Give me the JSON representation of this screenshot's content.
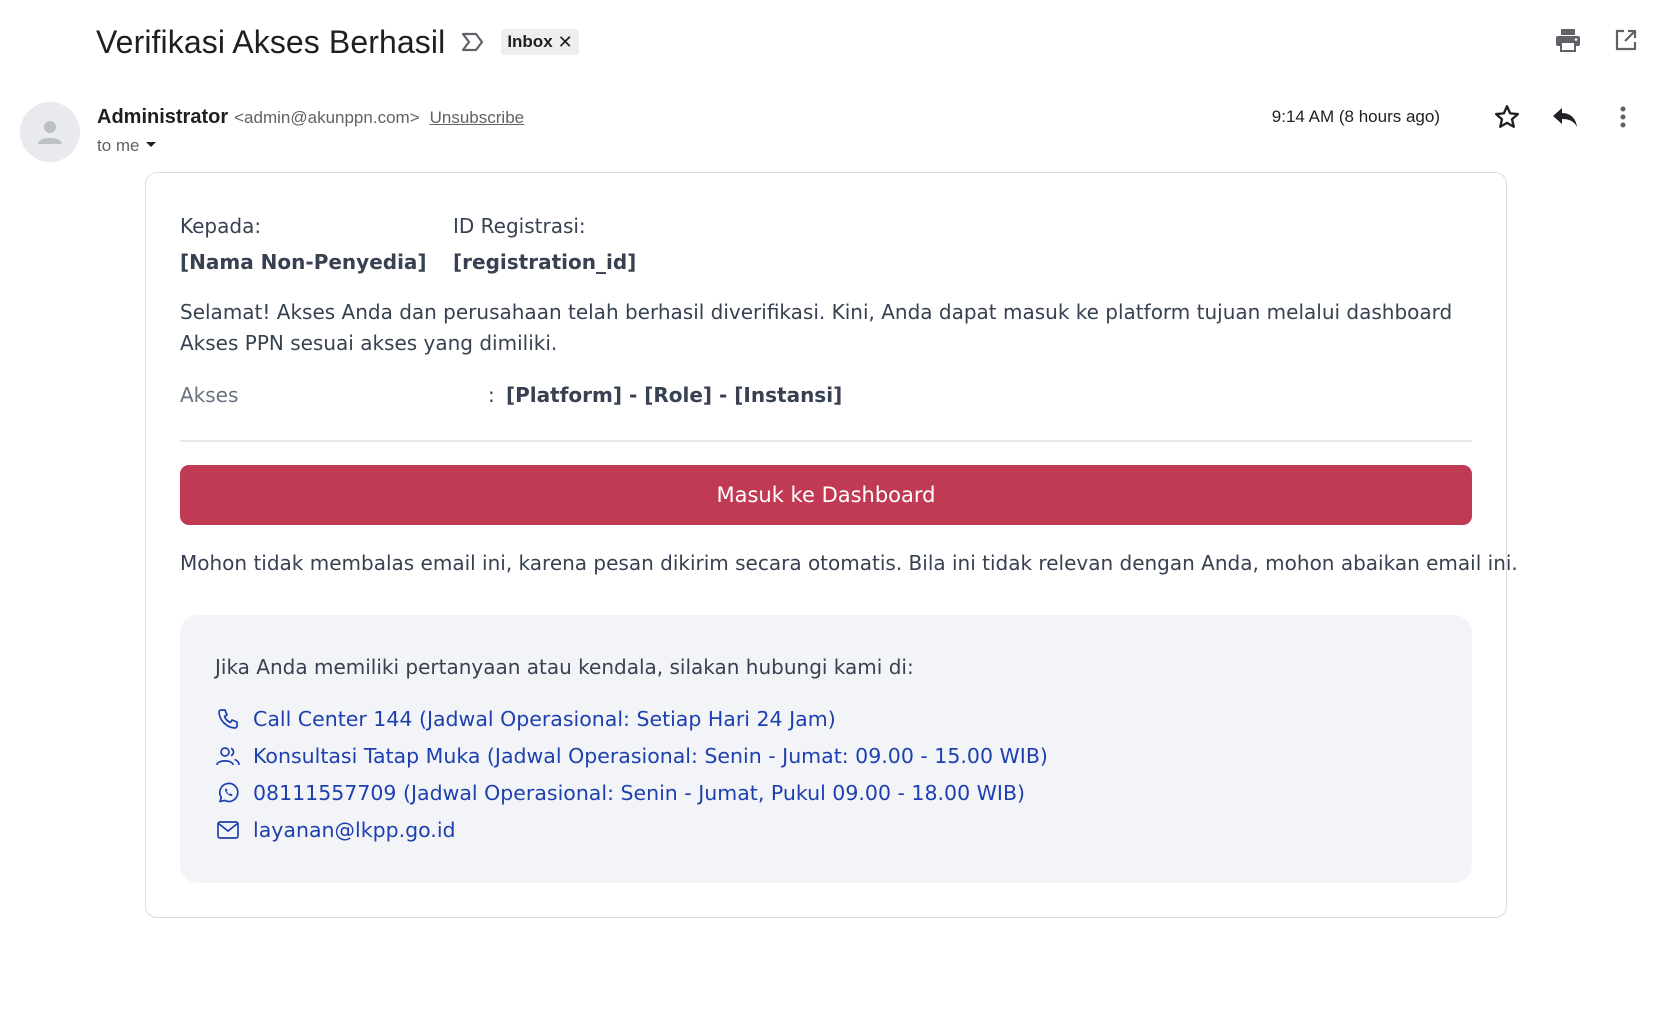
{
  "header": {
    "subject": "Verifikasi Akses Berhasil",
    "label": "Inbox"
  },
  "sender": {
    "name": "Administrator",
    "email": "<admin@akunppn.com>",
    "unsubscribe": "Unsubscribe",
    "to": "to me",
    "timestamp": "9:14 AM (8 hours ago)"
  },
  "email": {
    "to_label": "Kepada:",
    "to_value": "[Nama Non-Penyedia]",
    "id_label": "ID Registrasi:",
    "id_value": "[registration_id]",
    "body": "Selamat! Akses Anda dan perusahaan telah berhasil diverifikasi. Kini, Anda dapat masuk ke platform tujuan melalui dashboard Akses PPN sesuai akses yang dimiliki.",
    "akses_label": "Akses",
    "akses_sep": ":",
    "akses_value": "[Platform] - [Role] - [Instansi]",
    "cta_label": "Masuk ke Dashboard",
    "notice": "Mohon tidak membalas email ini, karena pesan dikirim secara otomatis. Bila ini tidak relevan dengan Anda, mohon abaikan email ini.",
    "contact_intro": "Jika Anda memiliki pertanyaan atau kendala, silakan hubungi kami di:",
    "contacts": [
      {
        "icon": "phone-icon",
        "text": "Call Center 144 (Jadwal Operasional: Setiap Hari 24 Jam)"
      },
      {
        "icon": "users-icon",
        "text": "Konsultasi Tatap Muka (Jadwal Operasional: Senin - Jumat: 09.00 - 15.00 WIB)"
      },
      {
        "icon": "whatsapp-icon",
        "text": "08111557709 (Jadwal Operasional: Senin - Jumat, Pukul 09.00 - 18.00 WIB)"
      },
      {
        "icon": "mail-icon",
        "text": "layanan@lkpp.go.id"
      }
    ]
  },
  "colors": {
    "cta": "#c03a53",
    "link": "#1e40af",
    "contact_bg": "#f3f4f7"
  }
}
